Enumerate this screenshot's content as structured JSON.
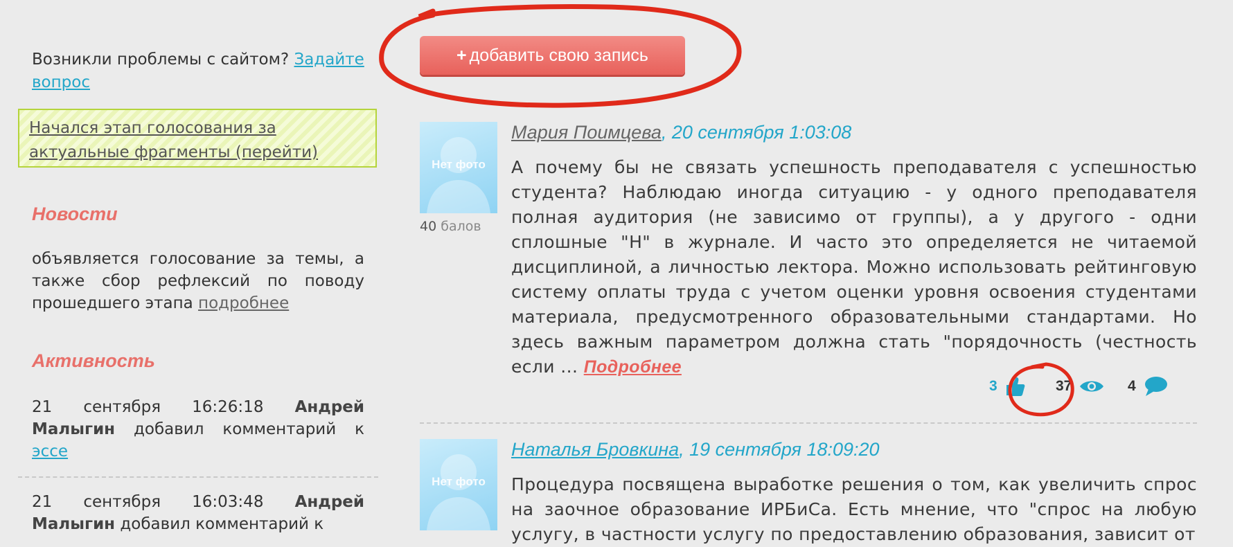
{
  "sidebar": {
    "problem_text": "Возникли проблемы с сайтом?",
    "problem_link": "Задайте вопрос",
    "notice_link": "Начался этап голосования за актуальные фрагменты (перейти)",
    "news_title": "Новости",
    "news_text": "объявляется голосование за темы, а также сбор рефлексий по поводу прошедшего этапа",
    "news_link": "подробнее",
    "activity_title": "Активность",
    "activity": [
      {
        "time": "21 сентября 16:26:18",
        "user": "Андрей Малыгин",
        "action": "добавил комментарий к",
        "link": "эссе"
      },
      {
        "time": "21 сентября 16:03:48",
        "user": "Андрей Малыгин",
        "action": "добавил комментарий к",
        "link": ""
      }
    ]
  },
  "main": {
    "add_button": "добавить свою запись",
    "add_button_plus": "+",
    "posts": [
      {
        "author": "Мария Поимцева",
        "date": ", 20 сентября 1:03:08",
        "avatar_text": "Нет фото",
        "score": "40",
        "score_unit": "балов",
        "text": "А почему бы не связать успешность преподавателя с успешностью студента? Наблюдаю иногда ситуацию - у одного преподавателя полная аудитория (не зависимо от группы), а у другого - одни сплошные \"Н\" в журнале. И часто это определяется не читаемой дисциплиной, а личностью лектора. Можно использовать рейтинговую систему оплаты труда с учетом оценки уровня освоения студентами материала, предусмотренного образовательными стандартами. Но здесь важным параметром должна стать \"порядочность (честность если ...",
        "more": "Подробнее",
        "likes": "3",
        "views": "37",
        "comments": "4"
      },
      {
        "author": "Наталья Бровкина",
        "date": ", 19 сентября 18:09:20",
        "avatar_text": "Нет фото",
        "text": "Процедура посвящена выработке решения о том, как увеличить спрос на заочное образование ИРБиСа. Есть мнение, что \"спрос на любую услугу, в частности услугу по предоставлению образования, зависит от"
      }
    ]
  },
  "colors": {
    "accent": "#23a6c9",
    "button": "#e8615b",
    "annotation": "#e02a1a"
  }
}
